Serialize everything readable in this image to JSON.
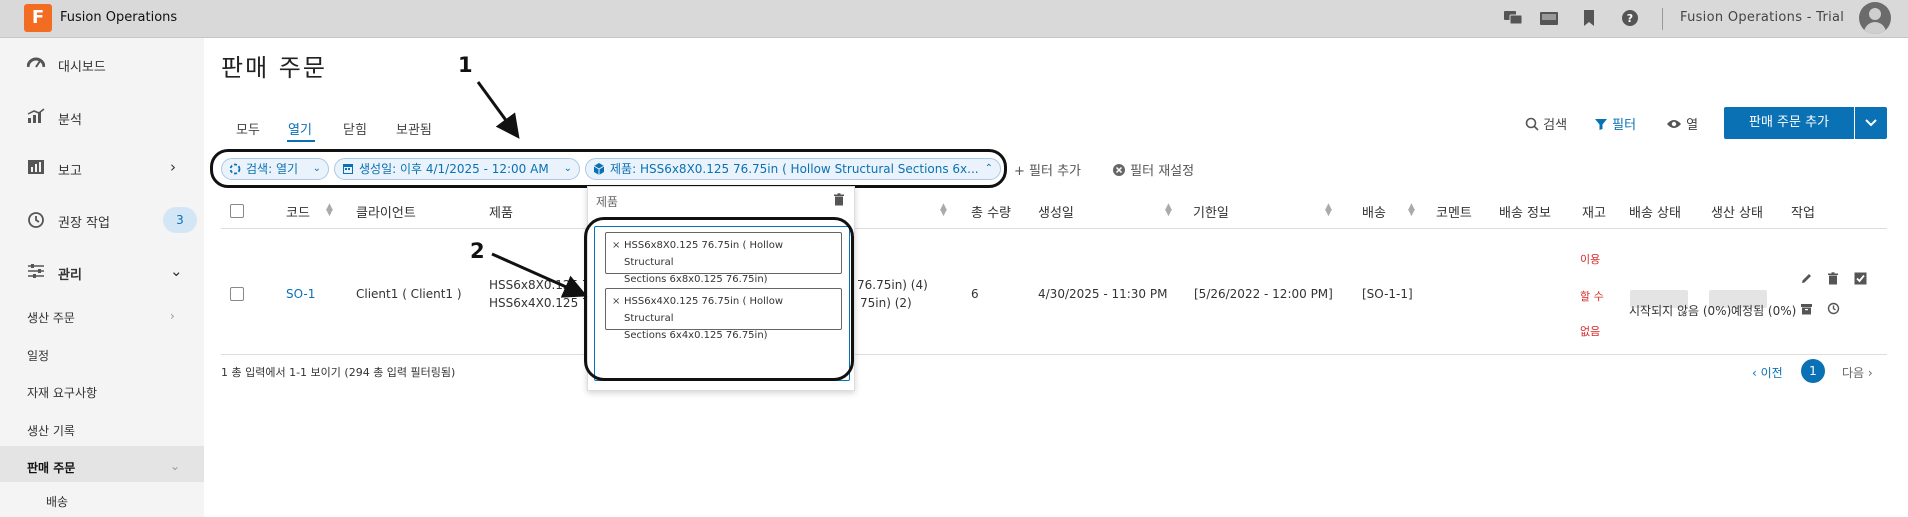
{
  "app": {
    "logo_letter": "F",
    "title": "Fusion Operations",
    "trial": "Fusion Operations - Trial"
  },
  "topbar": {
    "icons": [
      "chat-icon",
      "tray-icon",
      "bookmark-icon",
      "help-icon"
    ]
  },
  "sidebar": {
    "items": [
      {
        "label": "대시보드",
        "icon": "dashboard-icon"
      },
      {
        "label": "분석",
        "icon": "analytics-icon"
      },
      {
        "label": "보고",
        "icon": "report-icon",
        "chevron": "›"
      },
      {
        "label": "권장 작업",
        "icon": "history-icon",
        "badge": "3"
      },
      {
        "label": "관리",
        "icon": "sliders-icon",
        "chevron": "⌄"
      }
    ],
    "sub_items": [
      {
        "label": "생산 주문",
        "chevron": "›"
      },
      {
        "label": "일정"
      },
      {
        "label": "자재 요구사항"
      },
      {
        "label": "생산 기록"
      },
      {
        "label": "판매 주문",
        "chevron": "⌄"
      },
      {
        "label": "배송"
      }
    ]
  },
  "page": {
    "title": "판매 주문",
    "tabs": [
      "모두",
      "열기",
      "닫힘",
      "보관됨"
    ],
    "active_tab": "열기",
    "toolbar": {
      "search": "검색",
      "filter": "필터",
      "columns": "열",
      "add_button": "판매 주문 추가"
    }
  },
  "filters": {
    "chips": [
      {
        "label": "검색: 열기"
      },
      {
        "label": "생성일: 이후 4/1/2025 - 12:00 AM"
      },
      {
        "label": "제품: HSS6x8X0.125 76.75in ( Hollow Structural Sections 6x..."
      }
    ],
    "add_filter": "+ 필터 추가",
    "reset_filter": "필터 재설정"
  },
  "table": {
    "headers": [
      "코드",
      "클라이언트",
      "제품",
      "총 수량",
      "생성일",
      "기한일",
      "배송",
      "코멘트",
      "배송 정보",
      "재고",
      "배송 상태",
      "생산 상태",
      "작업"
    ],
    "rows": [
      {
        "code": "SO-1",
        "client": "Client1 ( Client1 )",
        "product_line1": "HSS6x8X0.125 76",
        "product_line2": "HSS6x4X0.125 76",
        "product_tail1": "76.75in) (4)",
        "product_tail2": "75in) (2)",
        "total_qty": "6",
        "created": "4/30/2025 - 11:30 PM",
        "due": "[5/26/2022 - 12:00 PM]",
        "shipping": "[SO-1-1]",
        "stock_line1": "이용",
        "stock_line2": "할 수",
        "stock_line3": "없음",
        "shipping_status": "시작되지 않음 (0%)",
        "production_status": "예정됨 (0%)"
      }
    ],
    "footer": "1 총 입력에서 1-1 보이기 (294 총 입력 필터링됨)",
    "pager": {
      "prev": "‹ 이전",
      "page": "1",
      "next": "다음 ›"
    }
  },
  "popup": {
    "title": "제품",
    "selected": [
      {
        "line1": "HSS6x8X0.125 76.75in ( Hollow Structural",
        "line2": "Sections 6x8x0.125 76.75in)"
      },
      {
        "line1": "HSS6x4X0.125 76.75in ( Hollow Structural",
        "line2": "Sections 6x4x0.125 76.75in)"
      }
    ]
  },
  "annotations": {
    "one": "1",
    "two": "2"
  },
  "colors": {
    "accent": "#0a71b5",
    "logo": "#f26c21",
    "warning": "#d92b2b"
  }
}
